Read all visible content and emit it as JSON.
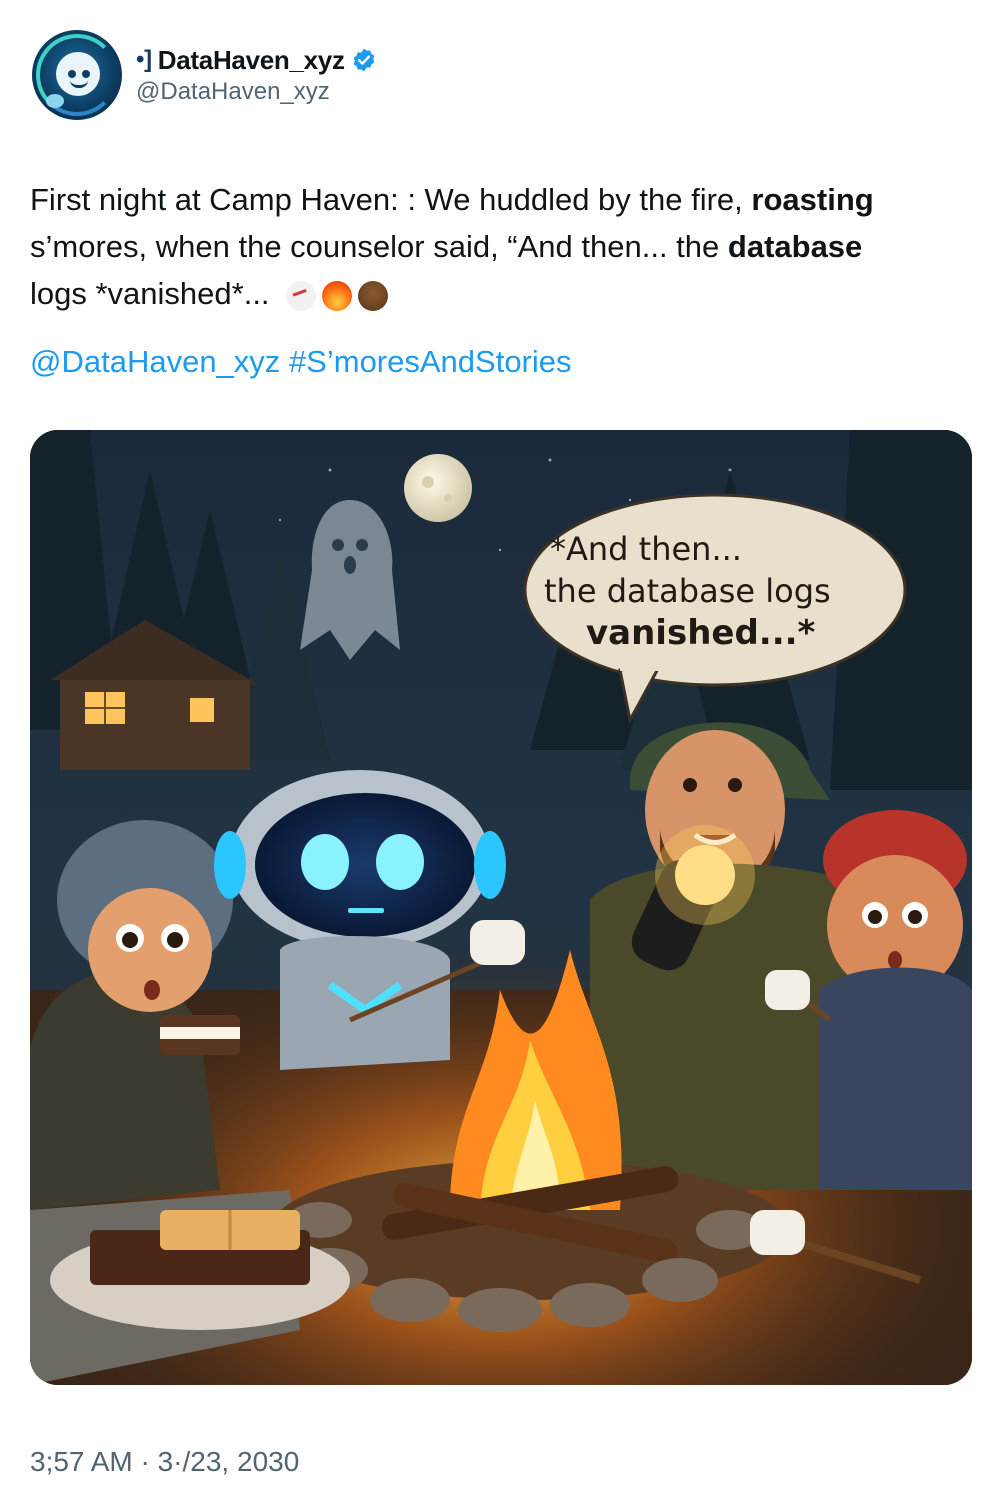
{
  "account": {
    "name_glyph": "•]",
    "display_name": "DataHaven_xyz",
    "handle": "@DataHaven_xyz",
    "verified": true,
    "avatar_icon": "robot-avatar-icon"
  },
  "tweet": {
    "line1_part1": "First night at Camp Haven: : ",
    "line1_part2": "We huddled by the fire, ",
    "line1_bold": "roasting",
    "line2_part1": "s’mores, when the counselor said, “And then... the ",
    "line2_bold": "database",
    "line3": "logs *vanished*...",
    "emojis": [
      "ghost-emoji",
      "fire-emoji",
      "scared-face-emoji"
    ],
    "mention": "@DataHaven_xyz",
    "hashtag": "#S’moresAndStories"
  },
  "image": {
    "bubble_line1": "*And then...",
    "bubble_line2": "the database logs",
    "bubble_line3": "vanished...*"
  },
  "timestamp": "3;57 AM · 3·/23, 2030",
  "colors": {
    "link": "#1d9bf0",
    "verified": "#1d9bf0",
    "secondary_text": "#536471"
  }
}
